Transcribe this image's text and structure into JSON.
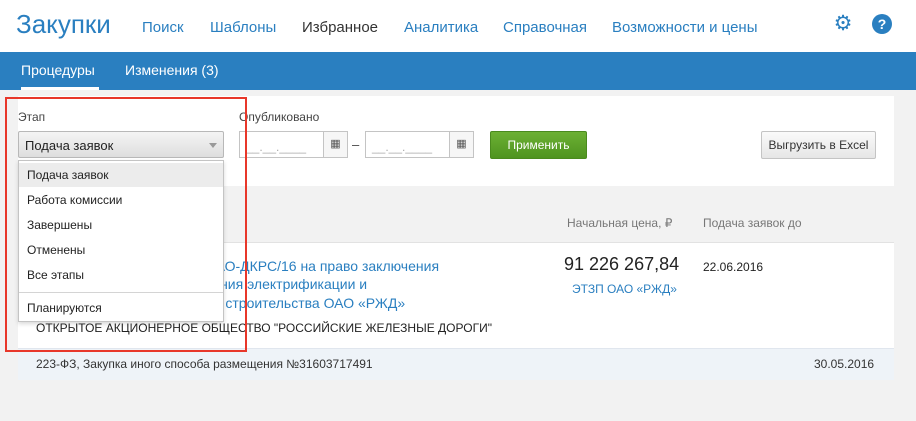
{
  "header": {
    "brand": "Закупки",
    "nav": [
      "Поиск",
      "Шаблоны",
      "Избранное",
      "Аналитика",
      "Справочная",
      "Возможности и цены"
    ],
    "active_nav": "Избранное",
    "settings_icon": "gear-icon",
    "help_icon": "help-icon",
    "help_glyph": "?"
  },
  "subnav": {
    "tabs": [
      "Процедуры",
      "Изменения (3)"
    ],
    "active_tab": "Процедуры"
  },
  "filters": {
    "stage_label": "Этап",
    "stage_value": "Подача заявок",
    "published_label": "Опубликовано",
    "date_from_placeholder": "__.__.____",
    "date_to_placeholder": "__.__.____",
    "date_separator": "–",
    "apply_label": "Применить",
    "export_label": "Выгрузить в Excel"
  },
  "dropdown": {
    "options": [
      "Подача заявок",
      "Работа комиссии",
      "Завершены",
      "Отменены",
      "Все этапы"
    ],
    "extra_option": "Планируются",
    "selected": "Подача заявок"
  },
  "columns": {
    "price": "Начальная цена, ₽",
    "deadline": "Подача заявок до"
  },
  "result": {
    "title_lines": [
      "ОАО-ДКРС/16 на право заключения",
      "вания электрификации и",
      "ты строительства ОАО «РЖД»"
    ],
    "organization": "ОТКРЫТОЕ АКЦИОНЕРНОЕ ОБЩЕСТВО \"РОССИЙСКИЕ ЖЕЛЕЗНЫЕ ДОРОГИ\"",
    "price": "91 226 267,84",
    "platform": "ЭТЗП ОАО «РЖД»",
    "deadline": "22.06.2016",
    "footer_info": "223-ФЗ, Закупка иного способа размещения №31603717491",
    "footer_date": "30.05.2016"
  },
  "colors": {
    "accent": "#2a7fc0",
    "apply_green": "#5aa12a",
    "highlight_red": "#e8372a"
  }
}
